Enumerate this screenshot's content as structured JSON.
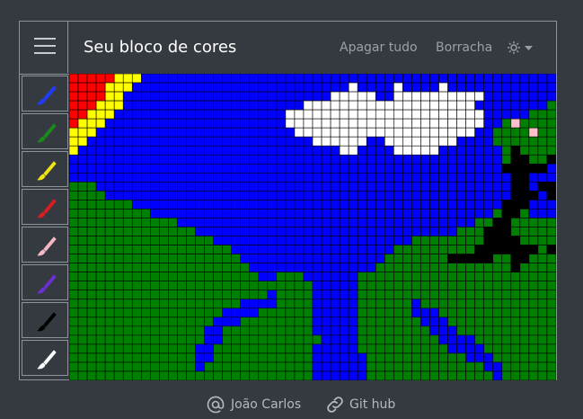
{
  "navbar": {
    "brand": "Seu bloco de cores",
    "clear_all": "Apagar tudo",
    "eraser": "Borracha",
    "settings_icon": "gear-icon"
  },
  "tools": [
    {
      "name": "brush-blue",
      "color": "#1e3cff"
    },
    {
      "name": "brush-green",
      "color": "#1a8a1a"
    },
    {
      "name": "brush-yellow",
      "color": "#f2e312"
    },
    {
      "name": "brush-red",
      "color": "#d81e1e"
    },
    {
      "name": "brush-pink",
      "color": "#f5b8c4"
    },
    {
      "name": "brush-purple",
      "color": "#6a2fd0"
    },
    {
      "name": "brush-black",
      "color": "#000000"
    },
    {
      "name": "brush-white",
      "color": "#ffffff"
    }
  ],
  "grid": {
    "cols": 54,
    "rows": 34,
    "palette": {
      "B": "#0000ff",
      "G": "#008000",
      "W": "#ffffff",
      "R": "#ff0000",
      "Y": "#ffff00",
      "K": "#000000",
      "P": "#ffc0cb"
    },
    "cells": [
      "RRRRRYYYBBBBBBBBBBBBBBBBBBBBBBBBBBBBBBBBBBBBBBBBBBBBBB",
      "RRRRYYYBBBBBBBBBBBBBBBBBBBBBBBBWBBBBWBBBBWBBBBBBBBBBBB",
      "RRRRYYBBBBBBBBBBBBBBBBBBBBBBBWWWWWBBWWWWWWWWWWBBBBBBBB",
      "RRRYYYBBBBBBBBBBBBBBBBBBBBWWWWWWWWWWWWWWWWWWWBBBBBBBBG",
      "RRYYYBBBBBBBBBBBBBBBBBBBWWWWWWWWWWWWWWWWWWWWWWBBBBBGGG",
      "RYYYBBBBBBBBBBBBBBBBBBBBWWWWWWWWWWWWWWWWWWWWWWBBGPGGGG",
      "YYYBBBBBBBBBBBBBBBBBBBBBBWWWWWWWWWWWWWWWWWWWWBBGGGGPGG",
      "YYBBBBBBBBBBBBBBBBBBBBBBBBBWWWWWWBBWWWWWWWWBBBBGGGGGGG",
      "YBBBBBBBBBBBBBBBBBBBBBBBBBBBBBWWBBBBWWWWWBBBBBBBGKGGGG",
      "BBBBBBBBBBBBBBBBBBBBBBBBBBBBBBBBBBBBBBBBBBBBBBBBGKKGGK",
      "BBBBBBBBBBBBBBBBBBBBBBBBBBBBBBBBBBBBBBBBBBBBBBBBKKKKKB",
      "BBBBBBBBBBBBBBBBBBBBBBBBBBBBBBBBBBBBBBBBBBBBBBBBBKKBBB",
      "GGGBBBBBBBBBBBBBBBBBBBBBBBBBBBBBBBBBBBBBBBBBBBBBBKKBKK",
      "GGGGBBBBBBBBBBBBBBBBBBBBBBBBBBBBBBBBBBBBBBBBBBBBBKKKBK",
      "GGGGGGGBBBBBBBBBBBBBBBBBBBBBBBBBBBBBBBBBBBBBBBBBKKKBBB",
      "GGGGGGGGGBBBBBBBBBBBBBBBBBBBBBBBBBBBBBBBBBBBBBBGKKGBBB",
      "GGGGGGGGGGGGBBBBBBBBBBBBBBBBBBBBBBBBBBBBBBBBBGGKKGGGGG",
      "GGGGGGGGGGGGGGBBBBBBBBBBBBBBBBBBBBBBBBBBBBBGGGKKKGGGGG",
      "GGGGGGGGGGGGGGGGBBBBBBBBBBBBBBBBBBBBBBGGGGGGGGKKKKGGGG",
      "GGGGGGGGGGGGGGGGGGBBBBBBBBBBBBBBBBBBGGGGGGGGGKKKKKKKGK",
      "GGGGGGGGGGGGGGGGGGGBBBBBBBBBBBBBBBBGGGGGGGKKKKKGGKKGGG",
      "GGGGGGGGGGGGGGGGGGGGBBBBBBBBBBBBBBGGGGGGGGGGGGGGGKGGGG",
      "GGGGGGGGGGGGGGGGGGGGGBBGGGBBBBBBGGGGGGGGGGGGGGGGGGGGGG",
      "GGGGGGGGGGGGGGGGGGGGGGGGGGGBBBBBGGGGGGGGGGGGGGGGGGGGGG",
      "GGGGGGGGGGGGGGGGGGGGGGBGGGGBBBBBGGGGGGGGGGGGGGGGGGGGGG",
      "GGGGGGGGGGGGGGGGGGGBBBBGGGGBBBBBGGGGGGBGGGGGGGGGGGGGGG",
      "GGGGGGGGGGGGGGGGGBBBBGGGGGGBBBBBGGGGGGBBBGGGGGGGGGGGGG",
      "GGGGGGGGGGGGGGGGBBBGGGGGGGGBBBBBGGGGGGGBBBGGGGGGGGGGGG",
      "GGGGGGGGGGGGGGGBBGGGGGGGGGGBBBBBGGGGGGGGBBBGGGGGGGGGGG",
      "GGGGGGGGGGGGGGGBBGGGGGGGGGGGBBBBGGGGGGGGGBBBBGGGGGGGGG",
      "GGGGGGGGGGGGGGBBGGGGGGGGGGGBBBBBGGGGGGGGGGBBBBGGGGGGGG",
      "GGGGGGGGGGGGGGBBGGGGGGGGGGGBBBBBBGGGGGGGGGGGBBBGGGGGGG",
      "GGGGGGGGGGGGGGBGGGGGGGGGGGGBBBBBBGGGGGGGGGGGGGBBGGGGGG",
      "GGGGGGGGGGGGGGGGGGGGGGGGGGGBBBBBBGGGGGGGGGGGGGGBGGGGGG"
    ]
  },
  "footer": {
    "author": "João Carlos",
    "github": "Git hub"
  }
}
